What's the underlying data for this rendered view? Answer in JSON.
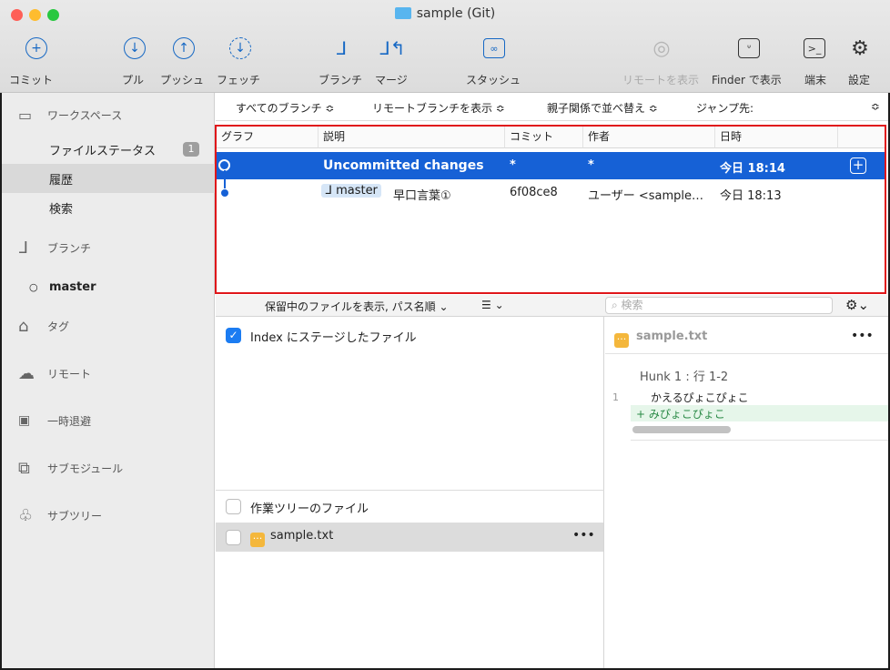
{
  "window": {
    "title": "sample (Git)"
  },
  "toolbar": {
    "commit": "コミット",
    "pull": "プル",
    "push": "プッシュ",
    "fetch": "フェッチ",
    "branch": "ブランチ",
    "merge": "マージ",
    "stash": "スタッシュ",
    "show_remote": "リモートを表示",
    "show_in_finder": "Finder で表示",
    "terminal": "端末",
    "settings": "設定"
  },
  "sidebar": {
    "workspace": "ワークスペース",
    "file_status": "ファイルステータス",
    "file_status_count": "1",
    "history": "履歴",
    "search": "検索",
    "branches": "ブランチ",
    "current_branch": "master",
    "tags": "タグ",
    "remotes": "リモート",
    "stashes": "一時退避",
    "submodules": "サブモジュール",
    "subtrees": "サブツリー"
  },
  "filters": {
    "all_branches": "すべてのブランチ ≎",
    "show_remote_branches": "リモートブランチを表示 ≎",
    "order": "親子関係で並べ替え ≎",
    "jump_to": "ジャンプ先:",
    "jump_chevron": "≎"
  },
  "history": {
    "columns": {
      "graph": "グラフ",
      "description": "説明",
      "commit": "コミット",
      "author": "作者",
      "date": "日時"
    },
    "rows": [
      {
        "description": "Uncommitted changes",
        "commit": "*",
        "author": "*",
        "date": "今日 18:14"
      },
      {
        "branch": "master",
        "description": "早口言葉①",
        "commit": "6f08ce8",
        "author": "ユーザー <sample…",
        "date": "今日 18:13"
      }
    ]
  },
  "lower": {
    "pending_label": "保留中のファイルを表示, パス名順 ⌄",
    "list_mode": "☰ ⌄",
    "search_placeholder": "検索",
    "gear": "⚙⌄"
  },
  "files": {
    "staged_title": "Index にステージしたファイル",
    "working_title": "作業ツリーのファイル",
    "working_files": [
      {
        "name": "sample.txt"
      }
    ],
    "more": "•••"
  },
  "diff": {
    "file": "sample.txt",
    "more": "•••",
    "hunk_header": "Hunk 1 : 行 1-2",
    "lines": [
      {
        "num": "1",
        "text": "かえるぴょこぴょこ"
      },
      {
        "num": "",
        "text": "+ みぴょこぴょこ"
      }
    ]
  },
  "colors": {
    "accent": "#1661d6",
    "highlight": "#e0161a"
  }
}
